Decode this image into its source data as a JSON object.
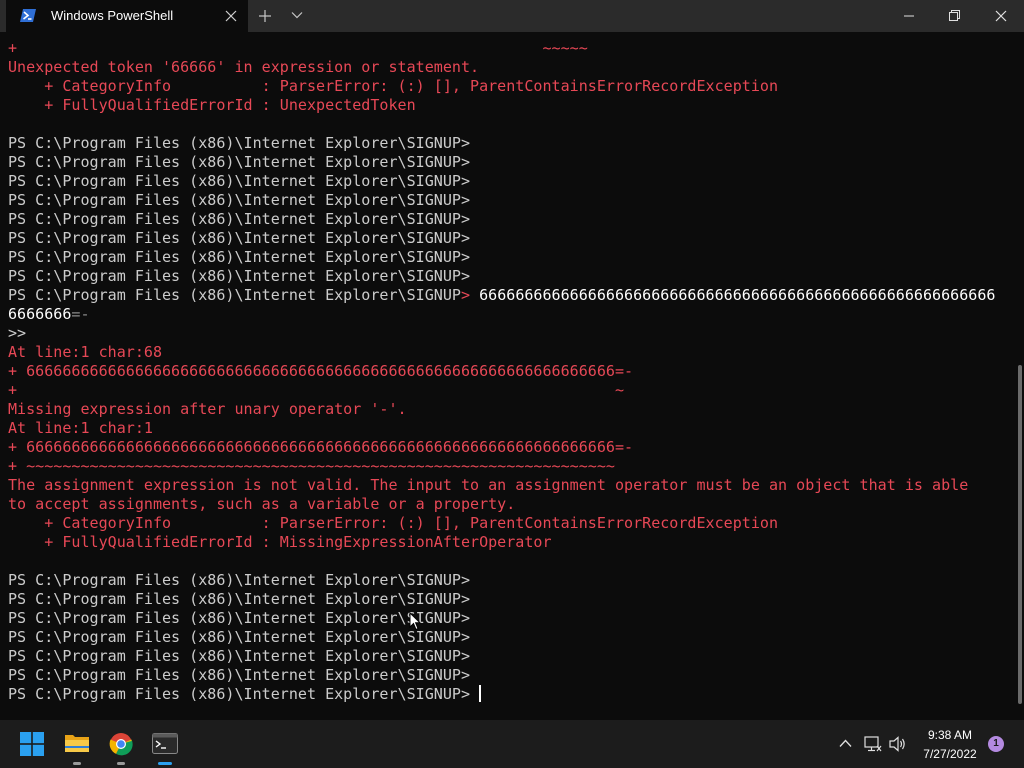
{
  "window": {
    "tab_title": "Windows PowerShell"
  },
  "terminal": {
    "prompt": "PS C:\\Program Files (x86)\\Internet Explorer\\SIGNUP",
    "lines": [
      {
        "kind": "err",
        "text": "+                                                          ~~~~~"
      },
      {
        "kind": "err",
        "text": "Unexpected token '66666' in expression or statement."
      },
      {
        "kind": "err",
        "text": "    + CategoryInfo          : ParserError: (:) [], ParentContainsErrorRecordException"
      },
      {
        "kind": "err",
        "text": "    + FullyQualifiedErrorId : UnexpectedToken"
      },
      {
        "kind": "blank",
        "text": ""
      },
      {
        "kind": "prompt",
        "text": "PS C:\\Program Files (x86)\\Internet Explorer\\SIGNUP>"
      },
      {
        "kind": "prompt",
        "text": "PS C:\\Program Files (x86)\\Internet Explorer\\SIGNUP>"
      },
      {
        "kind": "prompt",
        "text": "PS C:\\Program Files (x86)\\Internet Explorer\\SIGNUP>"
      },
      {
        "kind": "prompt",
        "text": "PS C:\\Program Files (x86)\\Internet Explorer\\SIGNUP>"
      },
      {
        "kind": "prompt",
        "text": "PS C:\\Program Files (x86)\\Internet Explorer\\SIGNUP>"
      },
      {
        "kind": "prompt",
        "text": "PS C:\\Program Files (x86)\\Internet Explorer\\SIGNUP>"
      },
      {
        "kind": "prompt",
        "text": "PS C:\\Program Files (x86)\\Internet Explorer\\SIGNUP>"
      },
      {
        "kind": "prompt",
        "text": "PS C:\\Program Files (x86)\\Internet Explorer\\SIGNUP>"
      },
      {
        "kind": "prompt_cmd",
        "text": "PS C:\\Program Files (x86)\\Internet Explorer\\SIGNUP",
        "cmd": "666666666666666666666666666666666666666666666666666666666"
      },
      {
        "kind": "cmd_cont",
        "text": "6666666",
        "tail": "=-"
      },
      {
        "kind": "prompt",
        "text": ">>"
      },
      {
        "kind": "err",
        "text": "At line:1 char:68"
      },
      {
        "kind": "err",
        "text": "+ 66666666666666666666666666666666666666666666666666666666666666666=-"
      },
      {
        "kind": "err",
        "text": "+                                                                  ~"
      },
      {
        "kind": "err",
        "text": "Missing expression after unary operator '-'."
      },
      {
        "kind": "err",
        "text": "At line:1 char:1"
      },
      {
        "kind": "err",
        "text": "+ 66666666666666666666666666666666666666666666666666666666666666666=-"
      },
      {
        "kind": "err",
        "text": "+ ~~~~~~~~~~~~~~~~~~~~~~~~~~~~~~~~~~~~~~~~~~~~~~~~~~~~~~~~~~~~~~~~~"
      },
      {
        "kind": "err",
        "text": "The assignment expression is not valid. The input to an assignment operator must be an object that is able"
      },
      {
        "kind": "err",
        "text": "to accept assignments, such as a variable or a property."
      },
      {
        "kind": "err",
        "text": "    + CategoryInfo          : ParserError: (:) [], ParentContainsErrorRecordException"
      },
      {
        "kind": "err",
        "text": "    + FullyQualifiedErrorId : MissingExpressionAfterOperator"
      },
      {
        "kind": "blank",
        "text": ""
      },
      {
        "kind": "prompt",
        "text": "PS C:\\Program Files (x86)\\Internet Explorer\\SIGNUP>"
      },
      {
        "kind": "prompt",
        "text": "PS C:\\Program Files (x86)\\Internet Explorer\\SIGNUP>"
      },
      {
        "kind": "prompt",
        "text": "PS C:\\Program Files (x86)\\Internet Explorer\\SIGNUP>"
      },
      {
        "kind": "prompt",
        "text": "PS C:\\Program Files (x86)\\Internet Explorer\\SIGNUP>"
      },
      {
        "kind": "prompt",
        "text": "PS C:\\Program Files (x86)\\Internet Explorer\\SIGNUP>"
      },
      {
        "kind": "prompt",
        "text": "PS C:\\Program Files (x86)\\Internet Explorer\\SIGNUP>"
      },
      {
        "kind": "prompt_cursor",
        "text": "PS C:\\Program Files (x86)\\Internet Explorer\\SIGNUP> "
      }
    ]
  },
  "taskbar": {
    "time": "9:38 AM",
    "date": "7/27/2022",
    "notification_count": "1",
    "apps": [
      "start-icon",
      "file-explorer-icon",
      "chrome-icon",
      "terminal-icon"
    ]
  },
  "colors": {
    "error": "#e74856",
    "text": "#cccccc",
    "background": "#0c0c0c",
    "titlebar": "#2b2b2b",
    "taskbar": "#1c1c1c",
    "accent": "#0078d4"
  }
}
